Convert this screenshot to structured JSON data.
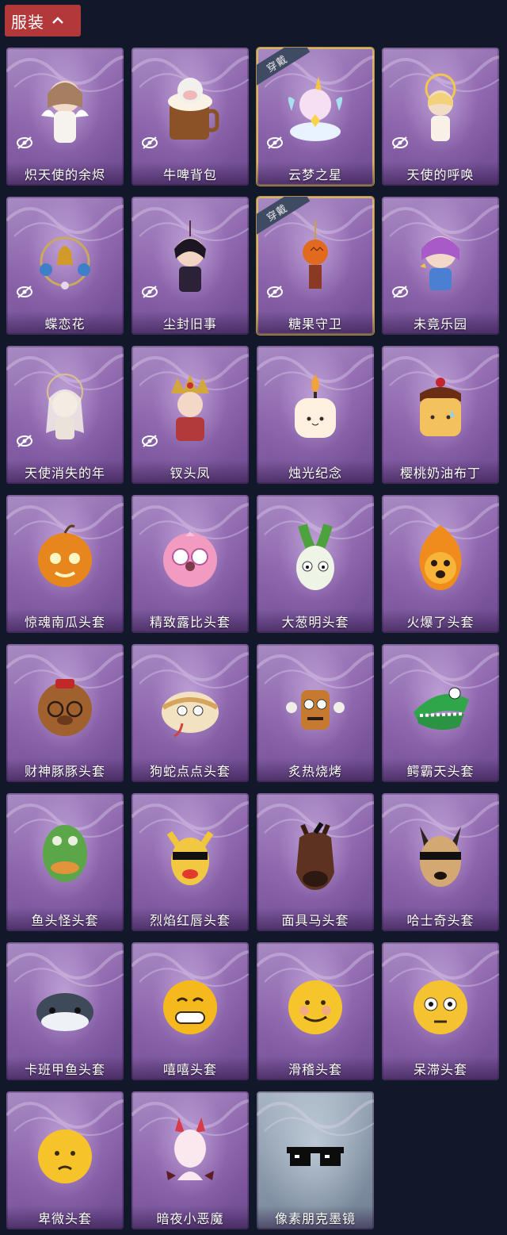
{
  "header": {
    "tab_label": "服装"
  },
  "badge_label": "穿戴",
  "items": [
    {
      "label": "炽天使的余烬",
      "hidden": true,
      "equipped": false,
      "style": "purple",
      "art": "angel-doll"
    },
    {
      "label": "牛啤背包",
      "hidden": true,
      "equipped": false,
      "style": "purple",
      "art": "cow-mug"
    },
    {
      "label": "云梦之星",
      "hidden": true,
      "equipped": true,
      "style": "purple",
      "art": "unicorn"
    },
    {
      "label": "天使的呼唤",
      "hidden": true,
      "equipped": false,
      "style": "purple",
      "art": "angel-halo"
    },
    {
      "label": "蝶恋花",
      "hidden": true,
      "equipped": false,
      "style": "purple",
      "art": "bell-wreath"
    },
    {
      "label": "尘封旧事",
      "hidden": true,
      "equipped": false,
      "style": "purple",
      "art": "dark-doll"
    },
    {
      "label": "糖果守卫",
      "hidden": true,
      "equipped": true,
      "style": "purple",
      "art": "pumpkin-charm"
    },
    {
      "label": "未竟乐园",
      "hidden": true,
      "equipped": false,
      "style": "purple",
      "art": "purple-girl"
    },
    {
      "label": "天使消失的年",
      "hidden": true,
      "equipped": false,
      "style": "purple",
      "art": "veiled-girl"
    },
    {
      "label": "钗头凤",
      "hidden": true,
      "equipped": false,
      "style": "purple",
      "art": "crown-girl"
    },
    {
      "label": "烛光纪念",
      "hidden": false,
      "equipped": false,
      "style": "purple",
      "art": "candle"
    },
    {
      "label": "樱桃奶油布丁",
      "hidden": false,
      "equipped": false,
      "style": "purple",
      "art": "pudding"
    },
    {
      "label": "惊魂南瓜头套",
      "hidden": false,
      "equipped": false,
      "style": "purple",
      "art": "pumpkin"
    },
    {
      "label": "精致露比头套",
      "hidden": false,
      "equipped": false,
      "style": "purple",
      "art": "pink-beaver"
    },
    {
      "label": "大葱明头套",
      "hidden": false,
      "equipped": false,
      "style": "purple",
      "art": "scallion"
    },
    {
      "label": "火爆了头套",
      "hidden": false,
      "equipped": false,
      "style": "purple",
      "art": "fireball"
    },
    {
      "label": "财神豚豚头套",
      "hidden": false,
      "equipped": false,
      "style": "purple",
      "art": "capybara"
    },
    {
      "label": "狗蛇点点头套",
      "hidden": false,
      "equipped": false,
      "style": "purple",
      "art": "dog-snake"
    },
    {
      "label": "炙热烧烤",
      "hidden": false,
      "equipped": false,
      "style": "purple",
      "art": "meat-bone"
    },
    {
      "label": "鳄霸天头套",
      "hidden": false,
      "equipped": false,
      "style": "purple",
      "art": "crocodile"
    },
    {
      "label": "鱼头怪头套",
      "hidden": false,
      "equipped": false,
      "style": "purple",
      "art": "fish-head"
    },
    {
      "label": "烈焰红唇头套",
      "hidden": false,
      "equipped": false,
      "style": "purple",
      "art": "yellow-lips"
    },
    {
      "label": "面具马头套",
      "hidden": false,
      "equipped": false,
      "style": "purple",
      "art": "horse"
    },
    {
      "label": "哈士奇头套",
      "hidden": false,
      "equipped": false,
      "style": "purple",
      "art": "husky"
    },
    {
      "label": "卡班甲鱼头套",
      "hidden": false,
      "equipped": false,
      "style": "purple",
      "art": "whale"
    },
    {
      "label": "嘻嘻头套",
      "hidden": false,
      "equipped": false,
      "style": "purple",
      "art": "grin-emoji"
    },
    {
      "label": "滑稽头套",
      "hidden": false,
      "equipped": false,
      "style": "purple",
      "art": "smirk-emoji"
    },
    {
      "label": "呆滞头套",
      "hidden": false,
      "equipped": false,
      "style": "purple",
      "art": "stare-emoji"
    },
    {
      "label": "卑微头套",
      "hidden": false,
      "equipped": false,
      "style": "purple",
      "art": "humble-emoji"
    },
    {
      "label": "暗夜小恶魔",
      "hidden": false,
      "equipped": false,
      "style": "purple",
      "art": "little-devil"
    },
    {
      "label": "像素朋克墨镜",
      "hidden": false,
      "equipped": false,
      "style": "gray",
      "art": "pixel-sunglasses"
    }
  ]
}
